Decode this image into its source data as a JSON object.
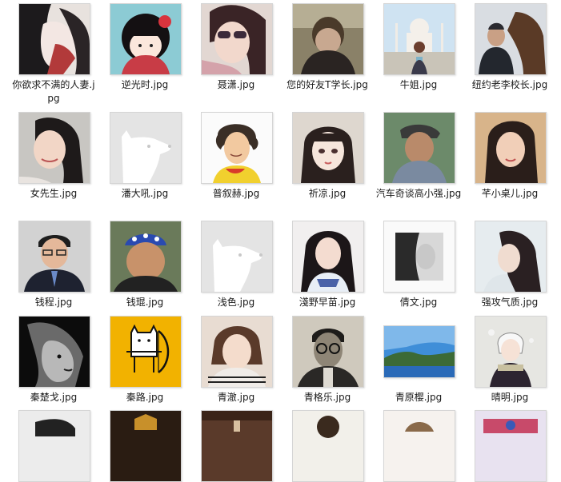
{
  "files": [
    {
      "name": "你欲求不满的人妻.jpg",
      "icon": "portrait-illustration-icon"
    },
    {
      "name": "逆光时.jpg",
      "icon": "doll-icon"
    },
    {
      "name": "聂潇.jpg",
      "icon": "portrait-icon"
    },
    {
      "name": "您的好友T学长.jpg",
      "icon": "portrait-icon"
    },
    {
      "name": "牛姐.jpg",
      "icon": "taj-mahal-icon"
    },
    {
      "name": "纽约老李校长.jpg",
      "icon": "horse-portrait-icon"
    },
    {
      "name": "女先生.jpg",
      "icon": "portrait-icon"
    },
    {
      "name": "潘大吼.jpg",
      "icon": "default-dog-avatar-icon"
    },
    {
      "name": "普叙赫.jpg",
      "icon": "cartoon-portrait-icon"
    },
    {
      "name": "祈凉.jpg",
      "icon": "illustration-portrait-icon"
    },
    {
      "name": "汽车奇谈高小强.jpg",
      "icon": "portrait-icon"
    },
    {
      "name": "芊小桌儿.jpg",
      "icon": "portrait-icon"
    },
    {
      "name": "钱程.jpg",
      "icon": "portrait-icon"
    },
    {
      "name": "钱琨.jpg",
      "icon": "portrait-icon"
    },
    {
      "name": "浅色.jpg",
      "icon": "default-dog-avatar-icon"
    },
    {
      "name": "淺野早苗.jpg",
      "icon": "portrait-icon"
    },
    {
      "name": "倩文.jpg",
      "icon": "bw-portrait-icon"
    },
    {
      "name": "强攻气质.jpg",
      "icon": "portrait-icon"
    },
    {
      "name": "秦楚戈.jpg",
      "icon": "lion-icon"
    },
    {
      "name": "秦路.jpg",
      "icon": "cartoon-archer-icon"
    },
    {
      "name": "青澈.jpg",
      "icon": "portrait-icon"
    },
    {
      "name": "青格乐.jpg",
      "icon": "vintage-portrait-icon"
    },
    {
      "name": "青原樱.jpg",
      "icon": "landscape-icon"
    },
    {
      "name": "晴明.jpg",
      "icon": "anime-character-icon"
    }
  ],
  "colors": {
    "selection": "#cce8ff",
    "text": "#1a1a1a",
    "archer_bg": "#f2b200"
  }
}
